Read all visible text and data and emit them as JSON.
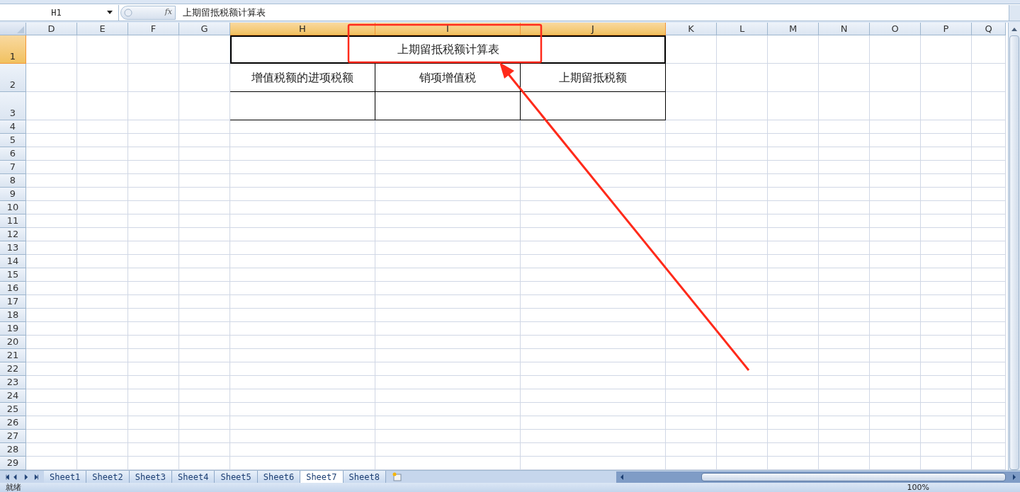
{
  "formula_bar": {
    "name_box": "H1",
    "fx_label": "fx",
    "formula": "上期留抵税额计算表"
  },
  "columns": [
    {
      "label": "D",
      "selected": false
    },
    {
      "label": "E",
      "selected": false
    },
    {
      "label": "F",
      "selected": false
    },
    {
      "label": "G",
      "selected": false
    },
    {
      "label": "H",
      "selected": true
    },
    {
      "label": "I",
      "selected": true
    },
    {
      "label": "J",
      "selected": true
    },
    {
      "label": "K",
      "selected": false
    },
    {
      "label": "L",
      "selected": false
    },
    {
      "label": "M",
      "selected": false
    },
    {
      "label": "N",
      "selected": false
    },
    {
      "label": "O",
      "selected": false
    },
    {
      "label": "P",
      "selected": false
    },
    {
      "label": "Q",
      "selected": false
    }
  ],
  "rows": [
    {
      "label": "1",
      "selected": true
    },
    {
      "label": "2",
      "selected": false
    },
    {
      "label": "3",
      "selected": false
    },
    {
      "label": "4",
      "selected": false
    },
    {
      "label": "5",
      "selected": false
    },
    {
      "label": "6",
      "selected": false
    },
    {
      "label": "7",
      "selected": false
    },
    {
      "label": "8",
      "selected": false
    },
    {
      "label": "9",
      "selected": false
    },
    {
      "label": "10",
      "selected": false
    },
    {
      "label": "11",
      "selected": false
    },
    {
      "label": "12",
      "selected": false
    },
    {
      "label": "13",
      "selected": false
    },
    {
      "label": "14",
      "selected": false
    },
    {
      "label": "15",
      "selected": false
    },
    {
      "label": "16",
      "selected": false
    },
    {
      "label": "17",
      "selected": false
    },
    {
      "label": "18",
      "selected": false
    },
    {
      "label": "19",
      "selected": false
    },
    {
      "label": "20",
      "selected": false
    },
    {
      "label": "21",
      "selected": false
    },
    {
      "label": "22",
      "selected": false
    },
    {
      "label": "23",
      "selected": false
    },
    {
      "label": "24",
      "selected": false
    },
    {
      "label": "25",
      "selected": false
    },
    {
      "label": "26",
      "selected": false
    },
    {
      "label": "27",
      "selected": false
    },
    {
      "label": "28",
      "selected": false
    },
    {
      "label": "29",
      "selected": false
    }
  ],
  "table": {
    "title": "上期留抵税额计算表",
    "headers": [
      "增值税额的进项税额",
      "销项增值税",
      "上期留抵税额"
    ]
  },
  "sheet_tabs": [
    {
      "label": "Sheet1",
      "selected": false
    },
    {
      "label": "Sheet2",
      "selected": false
    },
    {
      "label": "Sheet3",
      "selected": false
    },
    {
      "label": "Sheet4",
      "selected": false
    },
    {
      "label": "Sheet5",
      "selected": false
    },
    {
      "label": "Sheet6",
      "selected": false
    },
    {
      "label": "Sheet7",
      "selected": true
    },
    {
      "label": "Sheet8",
      "selected": false
    }
  ],
  "status_bar": {
    "status": "就绪",
    "zoom": "100%"
  }
}
